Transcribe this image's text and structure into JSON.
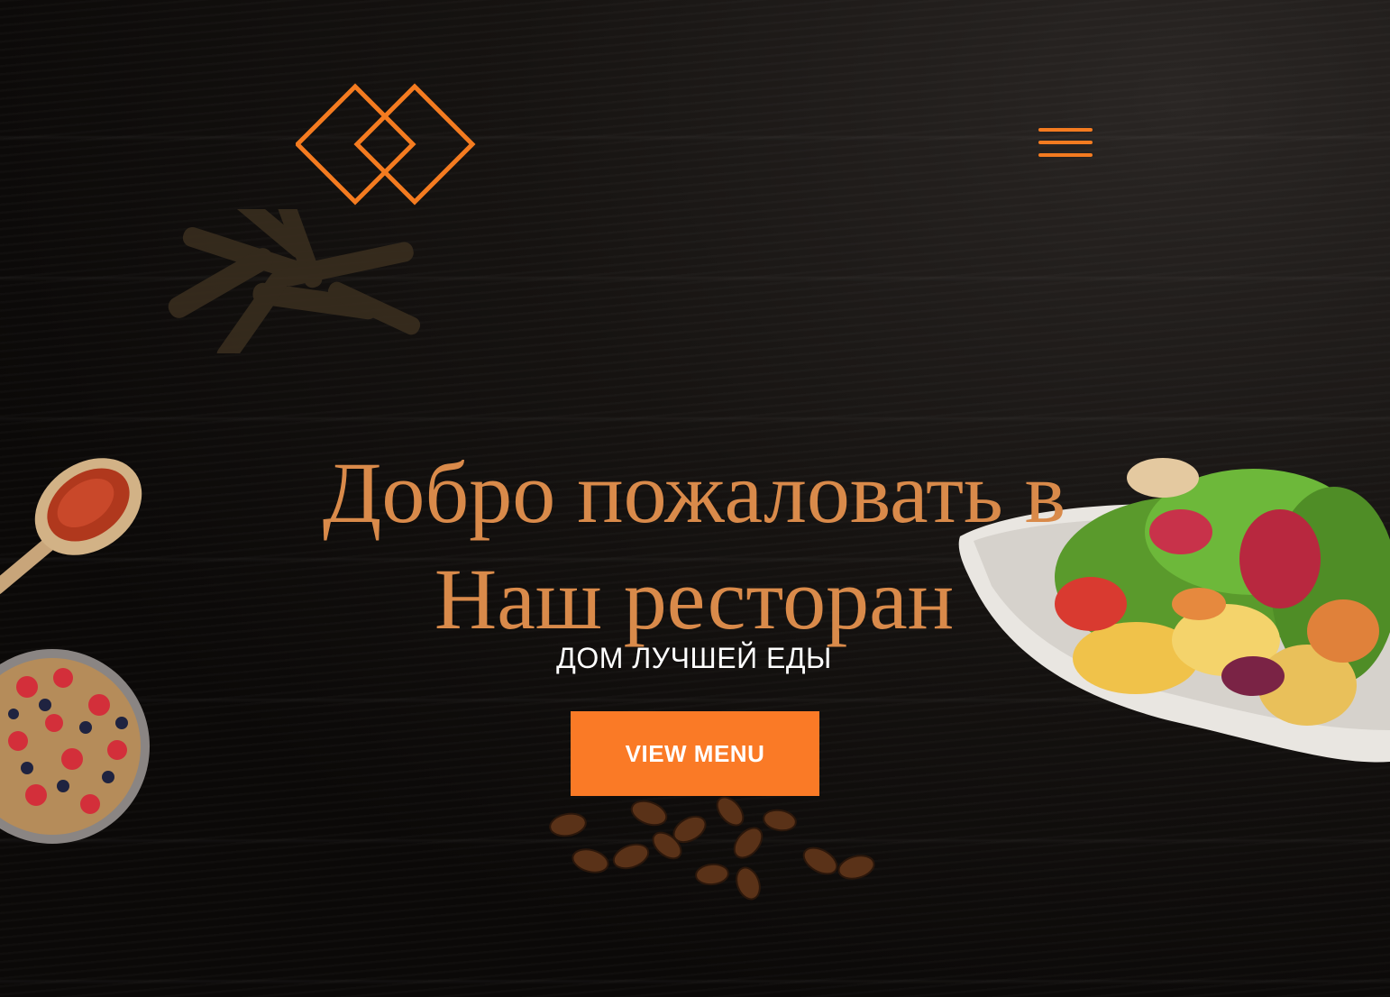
{
  "brand": {
    "logo_icon": "interlocking-diamonds-logo",
    "accent_color": "#f47b20",
    "title_color": "#d98a4a"
  },
  "nav": {
    "menu_icon": "hamburger-menu-icon"
  },
  "hero": {
    "title_line1": "Добро пожаловать в",
    "title_line2": "Наш ресторан",
    "subtitle": "ДОМ ЛУЧШЕЙ ЕДЫ",
    "cta_label": "VIEW MENU",
    "cta_color": "#fa7a26"
  },
  "decor": {
    "items": [
      "fries-image",
      "spice-spoon-image",
      "berry-bowl-image",
      "coffee-beans-image",
      "salad-plate-image"
    ]
  }
}
